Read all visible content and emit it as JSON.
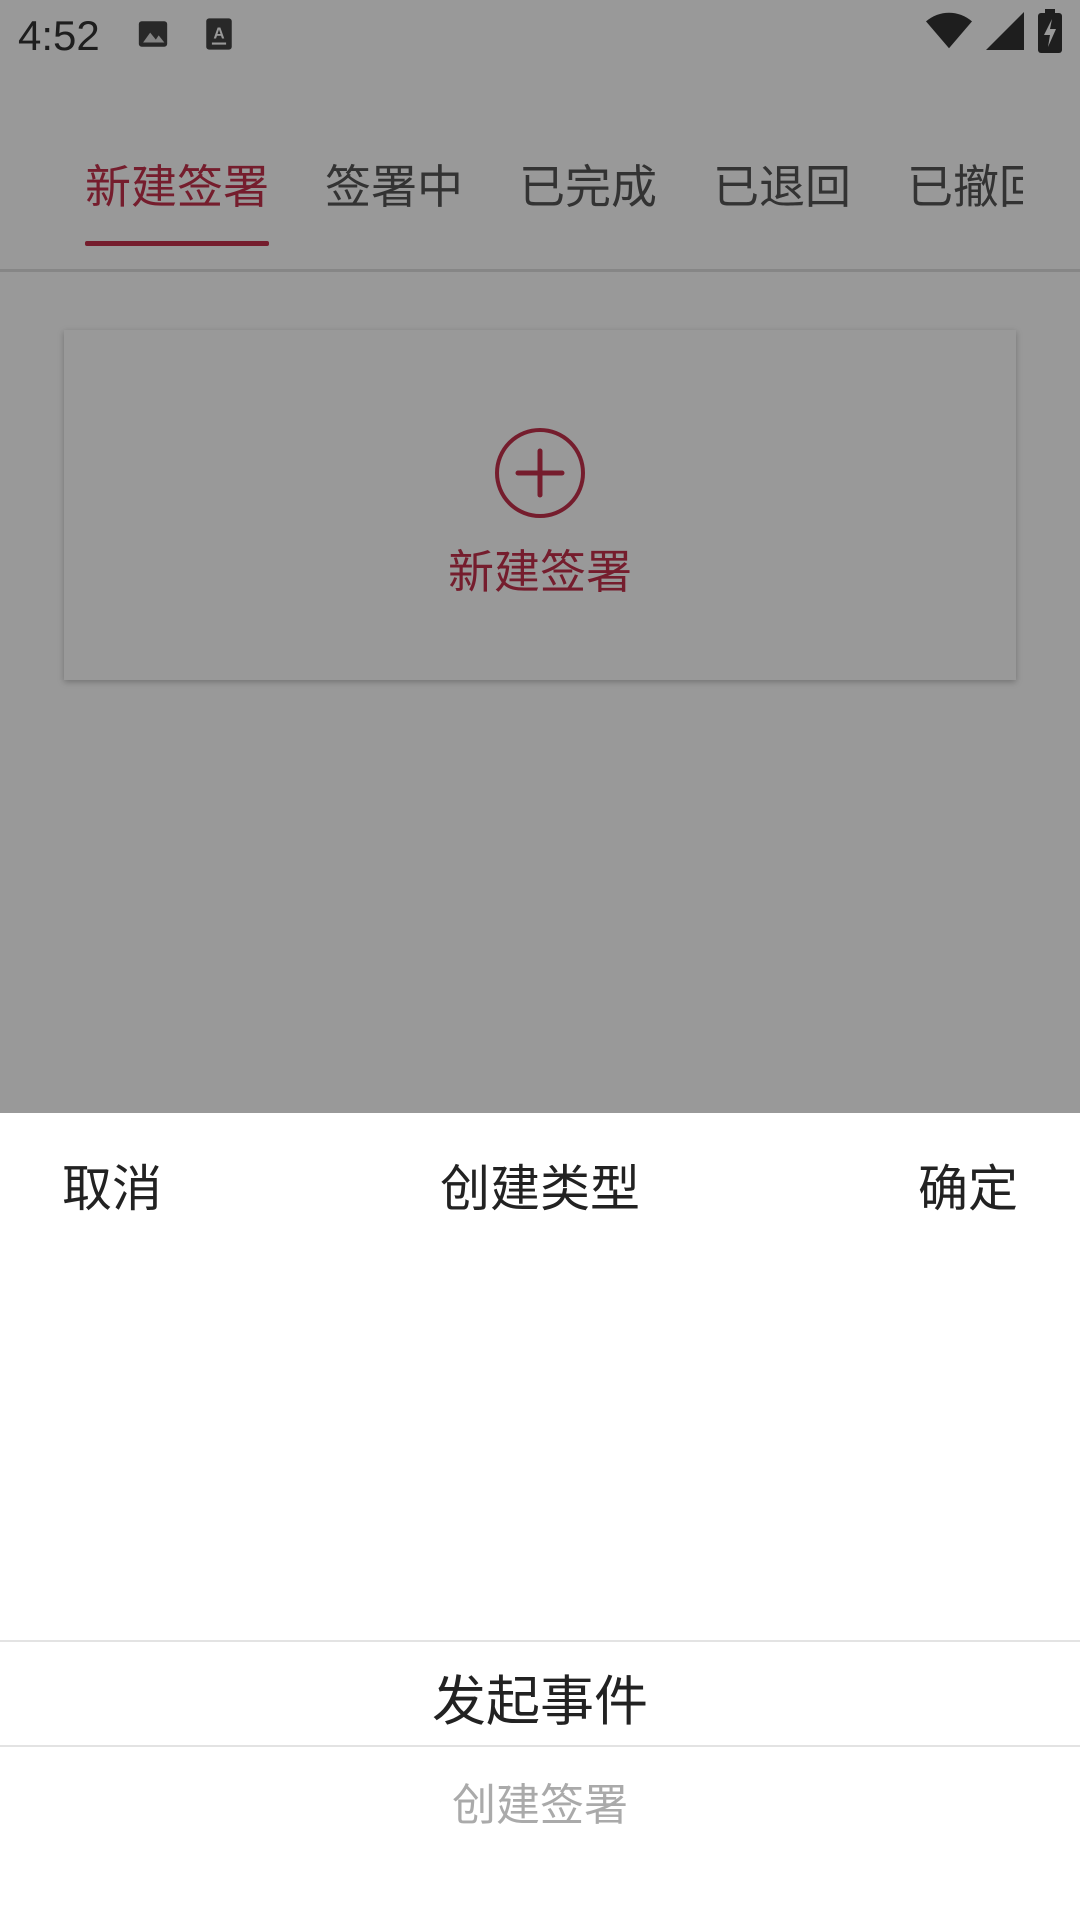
{
  "status_bar": {
    "time": "4:52",
    "left_icons": [
      "image-icon",
      "font-download-icon"
    ],
    "right_icons": [
      "wifi-icon",
      "cell-signal-icon",
      "battery-charging-icon"
    ]
  },
  "tabs": [
    {
      "label": "新建签署",
      "active": true
    },
    {
      "label": "签署中",
      "active": false
    },
    {
      "label": "已完成",
      "active": false
    },
    {
      "label": "已退回",
      "active": false
    },
    {
      "label": "已撤回",
      "active": false
    }
  ],
  "new_card": {
    "icon": "add-circle-icon",
    "label": "新建签署"
  },
  "picker": {
    "cancel_label": "取消",
    "title": "创建类型",
    "confirm_label": "确定",
    "options": [
      "发起事件",
      "创建签署"
    ],
    "selected_index": 0
  },
  "colors": {
    "accent": "#c4314b",
    "overlay": "rgba(0,0,0,0.4)"
  }
}
